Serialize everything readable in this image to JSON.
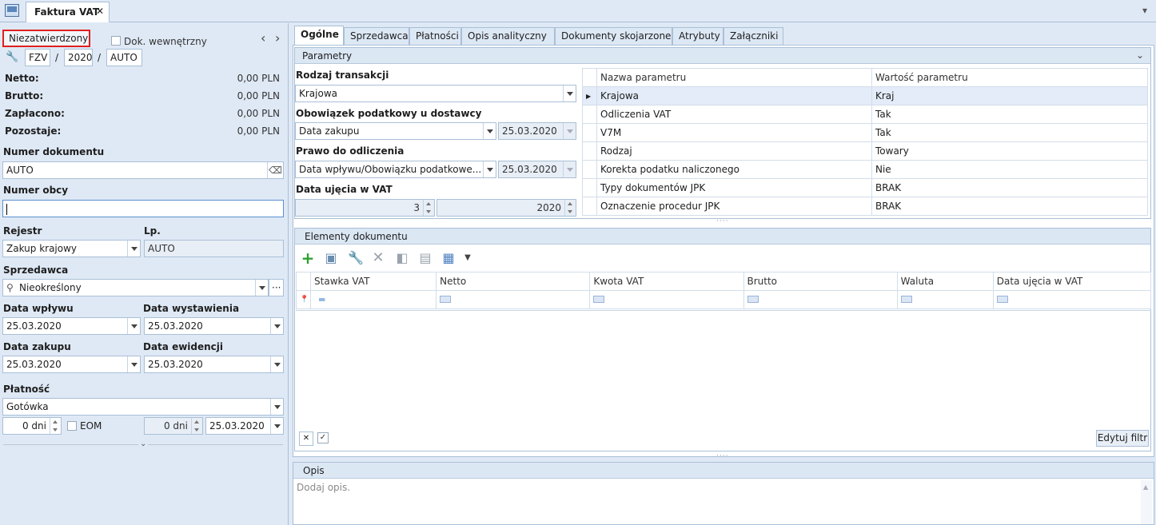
{
  "window": {
    "tab_title": "Faktura VAT",
    "close_glyph": "✕",
    "menu_glyph": "▾"
  },
  "left": {
    "status": "Niezatwierdzony",
    "internal_doc_label": "Dok. wewnętrzny",
    "nav_prev": "‹",
    "nav_next": "›",
    "number_parts": {
      "series": "FZV",
      "sep1": "/",
      "year": "2020",
      "sep2": "/",
      "auto": "AUTO"
    },
    "totals": [
      {
        "label": "Netto:",
        "value": "0,00 PLN"
      },
      {
        "label": "Brutto:",
        "value": "0,00 PLN"
      },
      {
        "label": "Zapłacono:",
        "value": "0,00 PLN"
      },
      {
        "label": "Pozostaje:",
        "value": "0,00 PLN"
      }
    ],
    "doc_number_label": "Numer dokumentu",
    "doc_number_value": "AUTO",
    "foreign_number_label": "Numer obcy",
    "foreign_number_value": "",
    "register_label": "Rejestr",
    "register_value": "Zakup krajowy",
    "lp_label": "Lp.",
    "lp_value": "AUTO",
    "seller_label": "Sprzedawca",
    "seller_value": "Nieokreślony",
    "date_received_label": "Data wpływu",
    "date_received_value": "25.03.2020",
    "date_issued_label": "Data wystawienia",
    "date_issued_value": "25.03.2020",
    "date_purchase_label": "Data zakupu",
    "date_purchase_value": "25.03.2020",
    "date_record_label": "Data ewidencji",
    "date_record_value": "25.03.2020",
    "payment_label": "Płatność",
    "payment_value": "Gotówka",
    "days_value": "0 dni",
    "eom_label": "EOM",
    "days2_value": "0 dni",
    "due_date_value": "25.03.2020"
  },
  "tabs": [
    "Ogólne",
    "Sprzedawca",
    "Płatności",
    "Opis analityczny",
    "Dokumenty skojarzone",
    "Atrybuty",
    "Załączniki"
  ],
  "params": {
    "header": "Parametry",
    "transaction_type_label": "Rodzaj transakcji",
    "transaction_type_value": "Krajowa",
    "tax_obligation_label": "Obowiązek podatkowy u dostawcy",
    "tax_obligation_value": "Data zakupu",
    "tax_obligation_date": "25.03.2020",
    "deduction_label": "Prawo do odliczenia",
    "deduction_value": "Data wpływu/Obowiązku podatkowe...",
    "deduction_date": "25.03.2020",
    "vat_date_label": "Data ujęcia w VAT",
    "vat_month": "3",
    "vat_year": "2020",
    "grid_columns": [
      "Nazwa parametru",
      "Wartość parametru"
    ],
    "grid_rows": [
      {
        "name": "Krajowa",
        "value": "Kraj"
      },
      {
        "name": "Odliczenia VAT",
        "value": "Tak"
      },
      {
        "name": "V7M",
        "value": "Tak"
      },
      {
        "name": "Rodzaj",
        "value": "Towary"
      },
      {
        "name": "Korekta podatku naliczonego",
        "value": "Nie"
      },
      {
        "name": "Typy dokumentów JPK",
        "value": "BRAK"
      },
      {
        "name": "Oznaczenie procedur JPK",
        "value": "BRAK"
      }
    ]
  },
  "elements": {
    "header": "Elementy dokumentu",
    "columns": [
      "Stawka VAT",
      "Netto",
      "Kwota VAT",
      "Brutto",
      "Waluta",
      "Data ujęcia w VAT"
    ],
    "filter_button": "Edytuj filtr"
  },
  "description": {
    "header": "Opis",
    "placeholder": "Dodaj opis."
  },
  "colors": {
    "accent": "#2e73c4",
    "status_border": "#e02020",
    "panel_bg": "#dfe9f5"
  }
}
